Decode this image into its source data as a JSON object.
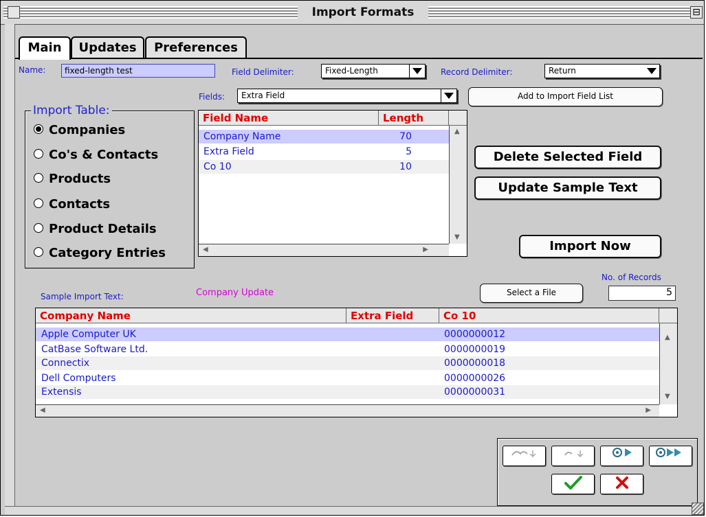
{
  "window": {
    "title": "Import Formats"
  },
  "tabs": [
    {
      "label": "Main",
      "active": true
    },
    {
      "label": "Updates",
      "active": false
    },
    {
      "label": "Preferences",
      "active": false
    }
  ],
  "name_field": {
    "label": "Name:",
    "value": "fixed-length test"
  },
  "field_delimiter": {
    "label": "Field Delimiter:",
    "value": "Fixed-Length"
  },
  "record_delimiter": {
    "label": "Record Delimiter:",
    "value": "Return"
  },
  "fields": {
    "label": "Fields:",
    "value": "Extra Field"
  },
  "add_button": "Add to Import Field List",
  "import_table": {
    "title": "Import Table:",
    "options": [
      "Companies",
      "Co's & Contacts",
      "Products",
      "Contacts",
      "Product Details",
      "Category Entries"
    ],
    "selected": "Companies"
  },
  "field_list": {
    "headers": [
      "Field Name",
      "Length"
    ],
    "rows": [
      [
        "Company Name",
        "70"
      ],
      [
        "Extra Field",
        "5"
      ],
      [
        "Co 10",
        "10"
      ]
    ]
  },
  "buttons": {
    "delete": "Delete Selected Field",
    "update_sample": "Update Sample Text",
    "import_now": "Import Now",
    "select_file": "Select a File"
  },
  "sample": {
    "label": "Sample Import Text:",
    "mode": "Company Update",
    "records_label": "No. of Records",
    "records_value": "5",
    "headers": [
      "Company Name",
      "Extra Field",
      "Co 10"
    ],
    "rows": [
      [
        "Apple Computer UK",
        "",
        "0000000012"
      ],
      [
        "CatBase Software Ltd.",
        "",
        "0000000019"
      ],
      [
        "Connectix",
        "",
        "0000000018"
      ],
      [
        "Dell Computers",
        "",
        "0000000026"
      ],
      [
        "Extensis",
        "",
        "0000000031"
      ]
    ]
  },
  "colors": {
    "accent_blue": "#1a1ac8",
    "header_red": "#e00000",
    "selection": "#ccccff",
    "mode_magenta": "#d800d8"
  },
  "icons": {
    "nav": [
      "undo-icon",
      "redo-icon",
      "next-record-icon",
      "last-record-icon"
    ],
    "ok": "checkmark-icon",
    "cancel": "x-icon"
  }
}
